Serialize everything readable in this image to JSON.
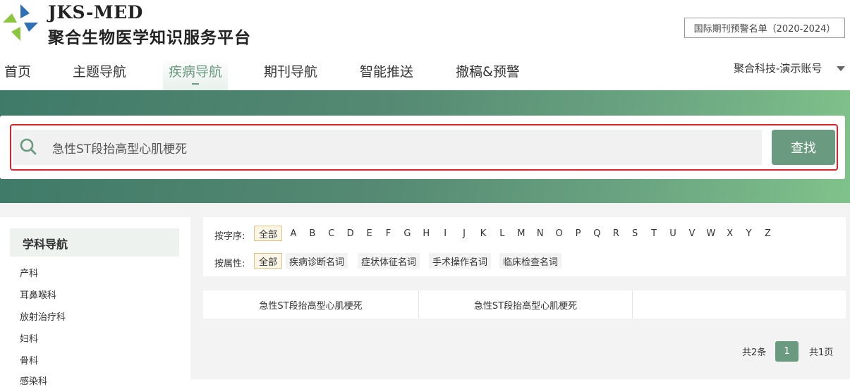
{
  "header": {
    "brand_en": "JKS-MED",
    "brand_cn": "聚合生物医学知识服务平台",
    "warning_list": "国际期刊预警名单（2020-2024）",
    "account": "聚合科技-演示账号"
  },
  "nav": {
    "items": [
      {
        "label": "首页"
      },
      {
        "label": "主题导航"
      },
      {
        "label": "疾病导航"
      },
      {
        "label": "期刊导航"
      },
      {
        "label": "智能推送"
      },
      {
        "label": "撤稿&预警"
      }
    ],
    "active": "疾病导航"
  },
  "search": {
    "value": "急性ST段抬高型心肌梗死",
    "button": "查找"
  },
  "sidebar": {
    "title": "学科导航",
    "items": [
      "产科",
      "耳鼻喉科",
      "放射治疗科",
      "妇科",
      "骨科",
      "感染科"
    ]
  },
  "filters": {
    "by_letter_label": "按字序:",
    "all": "全部",
    "letters": [
      "A",
      "B",
      "C",
      "D",
      "E",
      "F",
      "G",
      "H",
      "I",
      "J",
      "K",
      "L",
      "M",
      "N",
      "O",
      "P",
      "Q",
      "R",
      "S",
      "T",
      "U",
      "V",
      "W",
      "X",
      "Y",
      "Z"
    ],
    "by_attr_label": "按属性:",
    "attrs": [
      "疾病诊断名词",
      "症状体征名词",
      "手术操作名词",
      "临床检查名词"
    ]
  },
  "results": [
    "急性ST段抬高型心肌梗死",
    "急性ST段抬高型心肌梗死"
  ],
  "pager": {
    "total": "共2条",
    "current": "1",
    "pages": "共1页"
  },
  "colors": {
    "accent": "#6a9a7f",
    "highlight_border": "#d9242d",
    "chip_border": "#e2c27a"
  }
}
